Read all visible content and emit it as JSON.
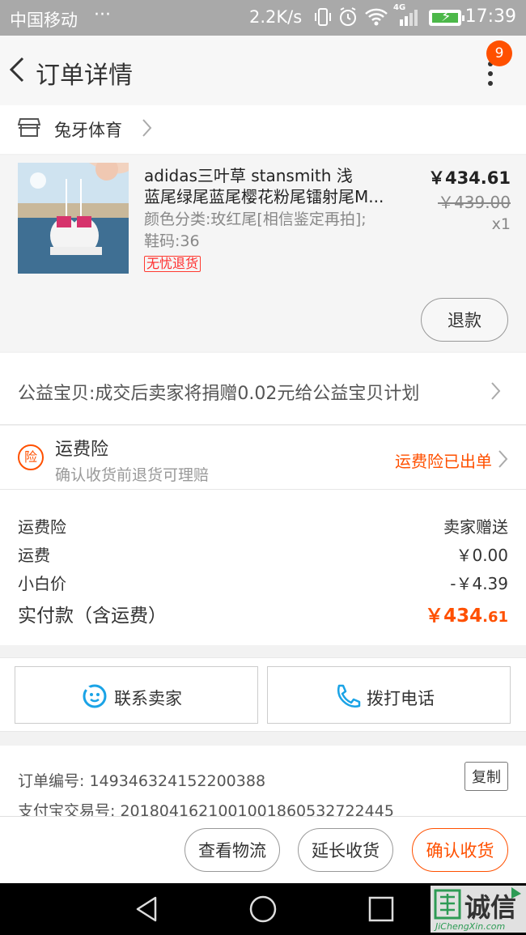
{
  "status_bar": {
    "carrier": "中国移动",
    "dots": "···",
    "net_speed": "2.2K/s",
    "network": "4G",
    "time": "17:39"
  },
  "header": {
    "title": "订单详情",
    "badge_count": "9"
  },
  "shop": {
    "name": "兔牙体育"
  },
  "product": {
    "title_line1": "adidas三叶草 stansmith 浅",
    "title_line2": "蓝尾绿尾蓝尾樱花粉尾镭射尾M...",
    "spec_line1": "颜色分类:玫红尾[相信鉴定再拍];",
    "spec_line2": "鞋码:36",
    "tag": "无忧退货",
    "price": "￥434.61",
    "original_price": "￥439.00",
    "quantity": "x1",
    "refund_label": "退款"
  },
  "charity": {
    "text": "公益宝贝:成交后卖家将捐赠0.02元给公益宝贝计划"
  },
  "insurance": {
    "icon_char": "险",
    "title": "运费险",
    "subtitle": "确认收货前退货可理赔",
    "status": "运费险已出单"
  },
  "summary": {
    "rows": [
      {
        "label": "运费险",
        "value": "卖家赠送"
      },
      {
        "label": "运费",
        "value": "￥0.00"
      },
      {
        "label": "小白价",
        "value": "-￥4.39"
      }
    ],
    "total_label": "实付款（含运费）",
    "total_main": "￥434",
    "total_decimal": ".61"
  },
  "contact": {
    "seller_label": "联系卖家",
    "phone_label": "拨打电话"
  },
  "order_info": {
    "order_no": "订单编号: 1493463241522003​88",
    "alipay_no": "支付宝交易号: 20180416210010018605327224​45",
    "copy_label": "复制"
  },
  "actions": {
    "logistics_label": "查看物流",
    "extend_label": "延长收货",
    "confirm_label": "确认收货"
  },
  "watermark": {
    "text": "诚信",
    "sub": "JiChengXin.com"
  },
  "colors": {
    "accent": "#ff5000",
    "chat_blue": "#1aa3e6",
    "tag_red": "#ff2d2d"
  }
}
